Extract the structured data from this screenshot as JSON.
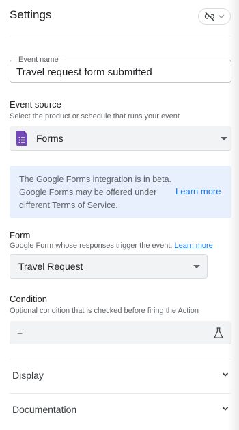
{
  "header": {
    "title": "Settings",
    "pill_icon": "link-off-icon",
    "pill_chevron": "chevron-down-icon"
  },
  "event_name": {
    "label": "Event name",
    "value": "Travel request form submitted"
  },
  "event_source": {
    "title": "Event source",
    "description": "Select the product or schedule that runs your event",
    "selected": "Forms",
    "icon": "google-forms-icon",
    "icon_color": "#7248b9"
  },
  "info": {
    "text": "The Google Forms integration is in beta. Google Forms may be offered under different Terms of Service.",
    "link": "Learn more",
    "background": "#e8f0fe"
  },
  "form": {
    "title": "Form",
    "description": "Google Form whose responses trigger the event.",
    "link": "Learn more",
    "selected": "Travel Request"
  },
  "condition": {
    "title": "Condition",
    "description": "Optional condition that is checked before firing the Action",
    "operator": "=",
    "icon": "flask-icon"
  },
  "sections": [
    {
      "label": "Display"
    },
    {
      "label": "Documentation"
    }
  ],
  "colors": {
    "link": "#1a73e8",
    "text": "#202124",
    "muted": "#5f6368"
  }
}
